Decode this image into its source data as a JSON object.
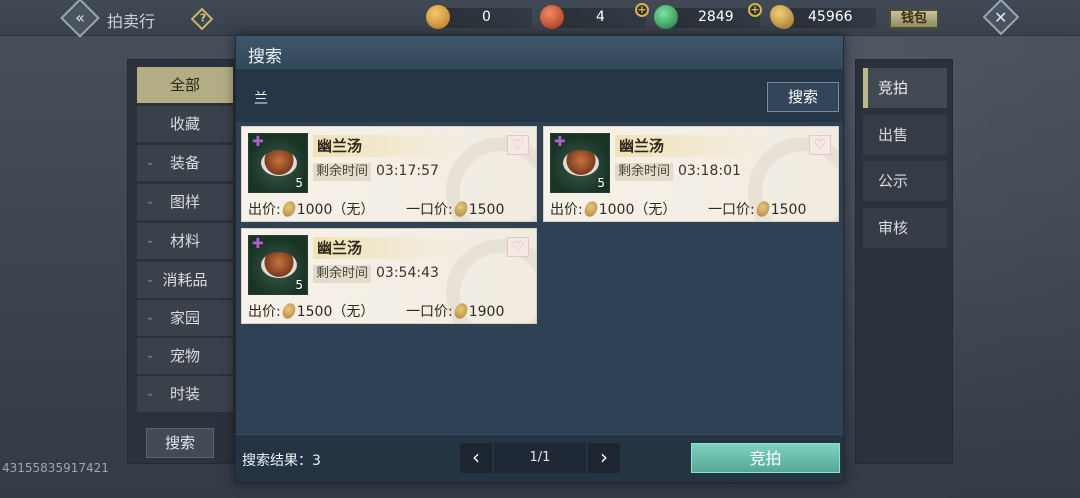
{
  "topbar": {
    "title": "拍卖行",
    "help_label": "?",
    "currencies": [
      {
        "name": "gold-ingot-icon",
        "value": "0",
        "color": "#d9a63a"
      },
      {
        "name": "red-orb-icon",
        "value": "4",
        "color": "#c8563a"
      },
      {
        "name": "jade-icon",
        "value": "2849",
        "color": "#3fb06a"
      },
      {
        "name": "gold-leaf-icon",
        "value": "45966",
        "color": "#c9a04a"
      }
    ],
    "wallet_label": "钱包",
    "close_label": "✕",
    "back_label": "«"
  },
  "left_panel": {
    "categories": [
      {
        "label": "全部",
        "active": true,
        "expandable": false
      },
      {
        "label": "收藏",
        "active": false,
        "expandable": false
      },
      {
        "label": "装备",
        "active": false,
        "expandable": true
      },
      {
        "label": "图样",
        "active": false,
        "expandable": true
      },
      {
        "label": "材料",
        "active": false,
        "expandable": true
      },
      {
        "label": "消耗品",
        "active": false,
        "expandable": true
      },
      {
        "label": "家园",
        "active": false,
        "expandable": true
      },
      {
        "label": "宠物",
        "active": false,
        "expandable": true
      },
      {
        "label": "时装",
        "active": false,
        "expandable": true
      }
    ],
    "search_button": "搜索"
  },
  "side_id": "43155835917421",
  "right_panel": {
    "tabs": [
      {
        "label": "竞拍",
        "active": true
      },
      {
        "label": "出售",
        "active": false
      },
      {
        "label": "公示",
        "active": false
      },
      {
        "label": "审核",
        "active": false
      }
    ]
  },
  "dialog": {
    "title": "搜索",
    "query": "兰",
    "search_button": "搜索",
    "results": [
      {
        "name": "幽兰汤",
        "quantity": "5",
        "time_label": "剩余时间",
        "time": "03:17:57",
        "bid_label": "出价:",
        "bid": "1000（无）",
        "buyout_label": "一口价:",
        "buyout": "1500"
      },
      {
        "name": "幽兰汤",
        "quantity": "5",
        "time_label": "剩余时间",
        "time": "03:18:01",
        "bid_label": "出价:",
        "bid": "1000（无）",
        "buyout_label": "一口价:",
        "buyout": "1500"
      },
      {
        "name": "幽兰汤",
        "quantity": "5",
        "time_label": "剩余时间",
        "time": "03:54:43",
        "bid_label": "出价:",
        "bid": "1500（无）",
        "buyout_label": "一口价:",
        "buyout": "1900"
      }
    ],
    "result_count_label": "搜索结果：3",
    "pagination": {
      "prev": "‹",
      "page": "1/1",
      "next": "›"
    },
    "bid_button": "竞拍"
  }
}
